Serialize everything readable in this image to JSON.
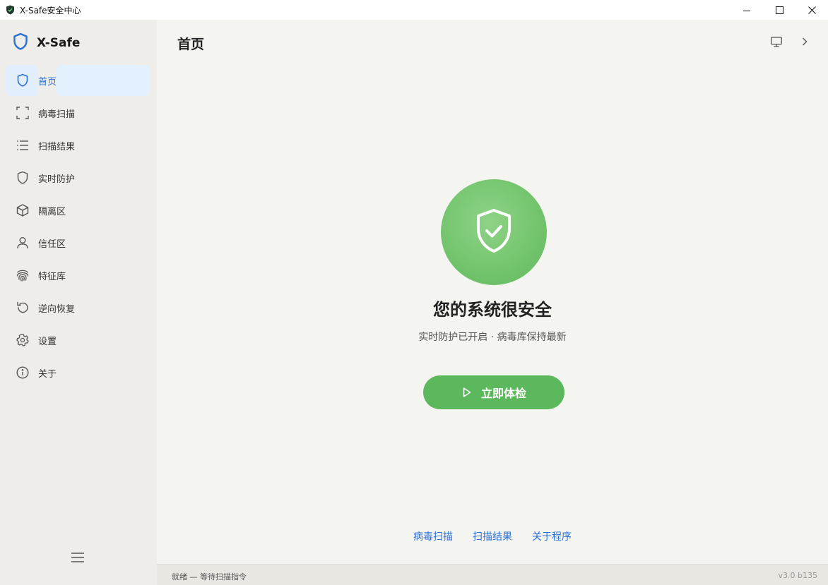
{
  "window": {
    "title": "X-Safe安全中心",
    "app_icon": "shield-icon",
    "controls": [
      "minimize-icon",
      "maximize-icon",
      "close-icon"
    ]
  },
  "sidebar": {
    "brand": "X-Safe",
    "brand_icon": "shield-icon",
    "active_index": 0,
    "items": [
      {
        "label": "首页",
        "icon": "shield-icon"
      },
      {
        "label": "病毒扫描",
        "icon": "scan-frame-icon"
      },
      {
        "label": "扫描结果",
        "icon": "list-icon"
      },
      {
        "label": "实时防护",
        "icon": "shield-icon"
      },
      {
        "label": "隔离区",
        "icon": "box-icon"
      },
      {
        "label": "信任区",
        "icon": "user-icon"
      },
      {
        "label": "特征库",
        "icon": "fingerprint-icon"
      },
      {
        "label": "逆向恢复",
        "icon": "restore-icon"
      },
      {
        "label": "设置",
        "icon": "gear-icon"
      },
      {
        "label": "关于",
        "icon": "info-icon"
      }
    ],
    "menu_icon": "hamburger-icon"
  },
  "header": {
    "title": "首页",
    "icons": [
      "monitor-icon",
      "chevron-right-icon"
    ]
  },
  "status": {
    "icon": "shield-check-icon",
    "title": "您的系统很安全",
    "subtitle": "实时防护已开启 · 病毒库保持最新"
  },
  "action": {
    "label": "立即体检",
    "icon": "play-icon"
  },
  "footer_links": [
    "病毒扫描",
    "扫描结果",
    "关于程序"
  ],
  "statusbar": {
    "left": "就绪 — 等待扫描指令",
    "right": "v3.0 b135"
  },
  "colors": {
    "accent": "#2a6fd6",
    "safe_green": "#5cb85c",
    "sidebar_bg": "#eeede9",
    "main_bg": "#f4f4f1"
  }
}
